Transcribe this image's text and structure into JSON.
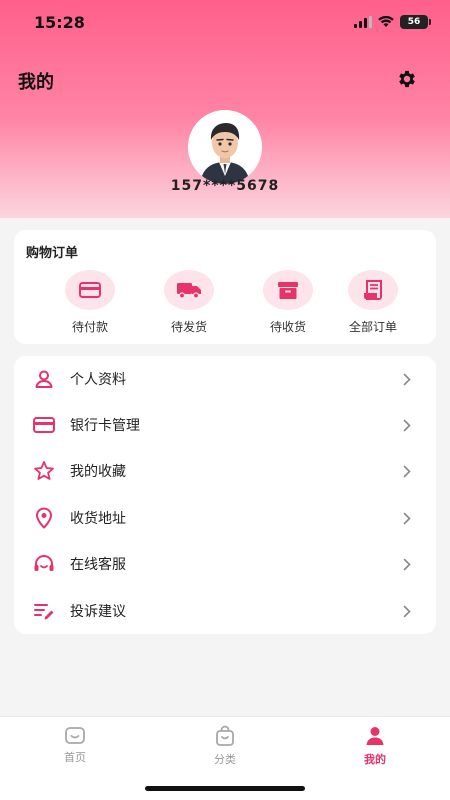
{
  "status_bar": {
    "time": "15:28",
    "battery": "56"
  },
  "header": {
    "title": "我的",
    "phone": "157****5678"
  },
  "orders": {
    "title": "购物订单",
    "items": [
      {
        "label": "待付款",
        "icon": "card-icon"
      },
      {
        "label": "待发货",
        "icon": "truck-icon"
      },
      {
        "label": "待收货",
        "icon": "box-icon"
      },
      {
        "label": "全部订单",
        "icon": "receipt-icon"
      }
    ]
  },
  "menu": {
    "items": [
      {
        "label": "个人资料",
        "icon": "user-icon"
      },
      {
        "label": "银行卡管理",
        "icon": "bank-card-icon"
      },
      {
        "label": "我的收藏",
        "icon": "star-icon"
      },
      {
        "label": "收货地址",
        "icon": "location-pin-icon"
      },
      {
        "label": "在线客服",
        "icon": "headset-icon"
      },
      {
        "label": "投诉建议",
        "icon": "feedback-icon"
      }
    ]
  },
  "tabbar": {
    "tabs": [
      {
        "label": "首页",
        "icon": "home-icon"
      },
      {
        "label": "分类",
        "icon": "bag-icon"
      },
      {
        "label": "我的",
        "icon": "profile-icon",
        "active": true
      }
    ]
  },
  "colors": {
    "accent": "#e8336a",
    "header_top": "#ff5f8b",
    "icon_bg": "#fde3ea"
  }
}
